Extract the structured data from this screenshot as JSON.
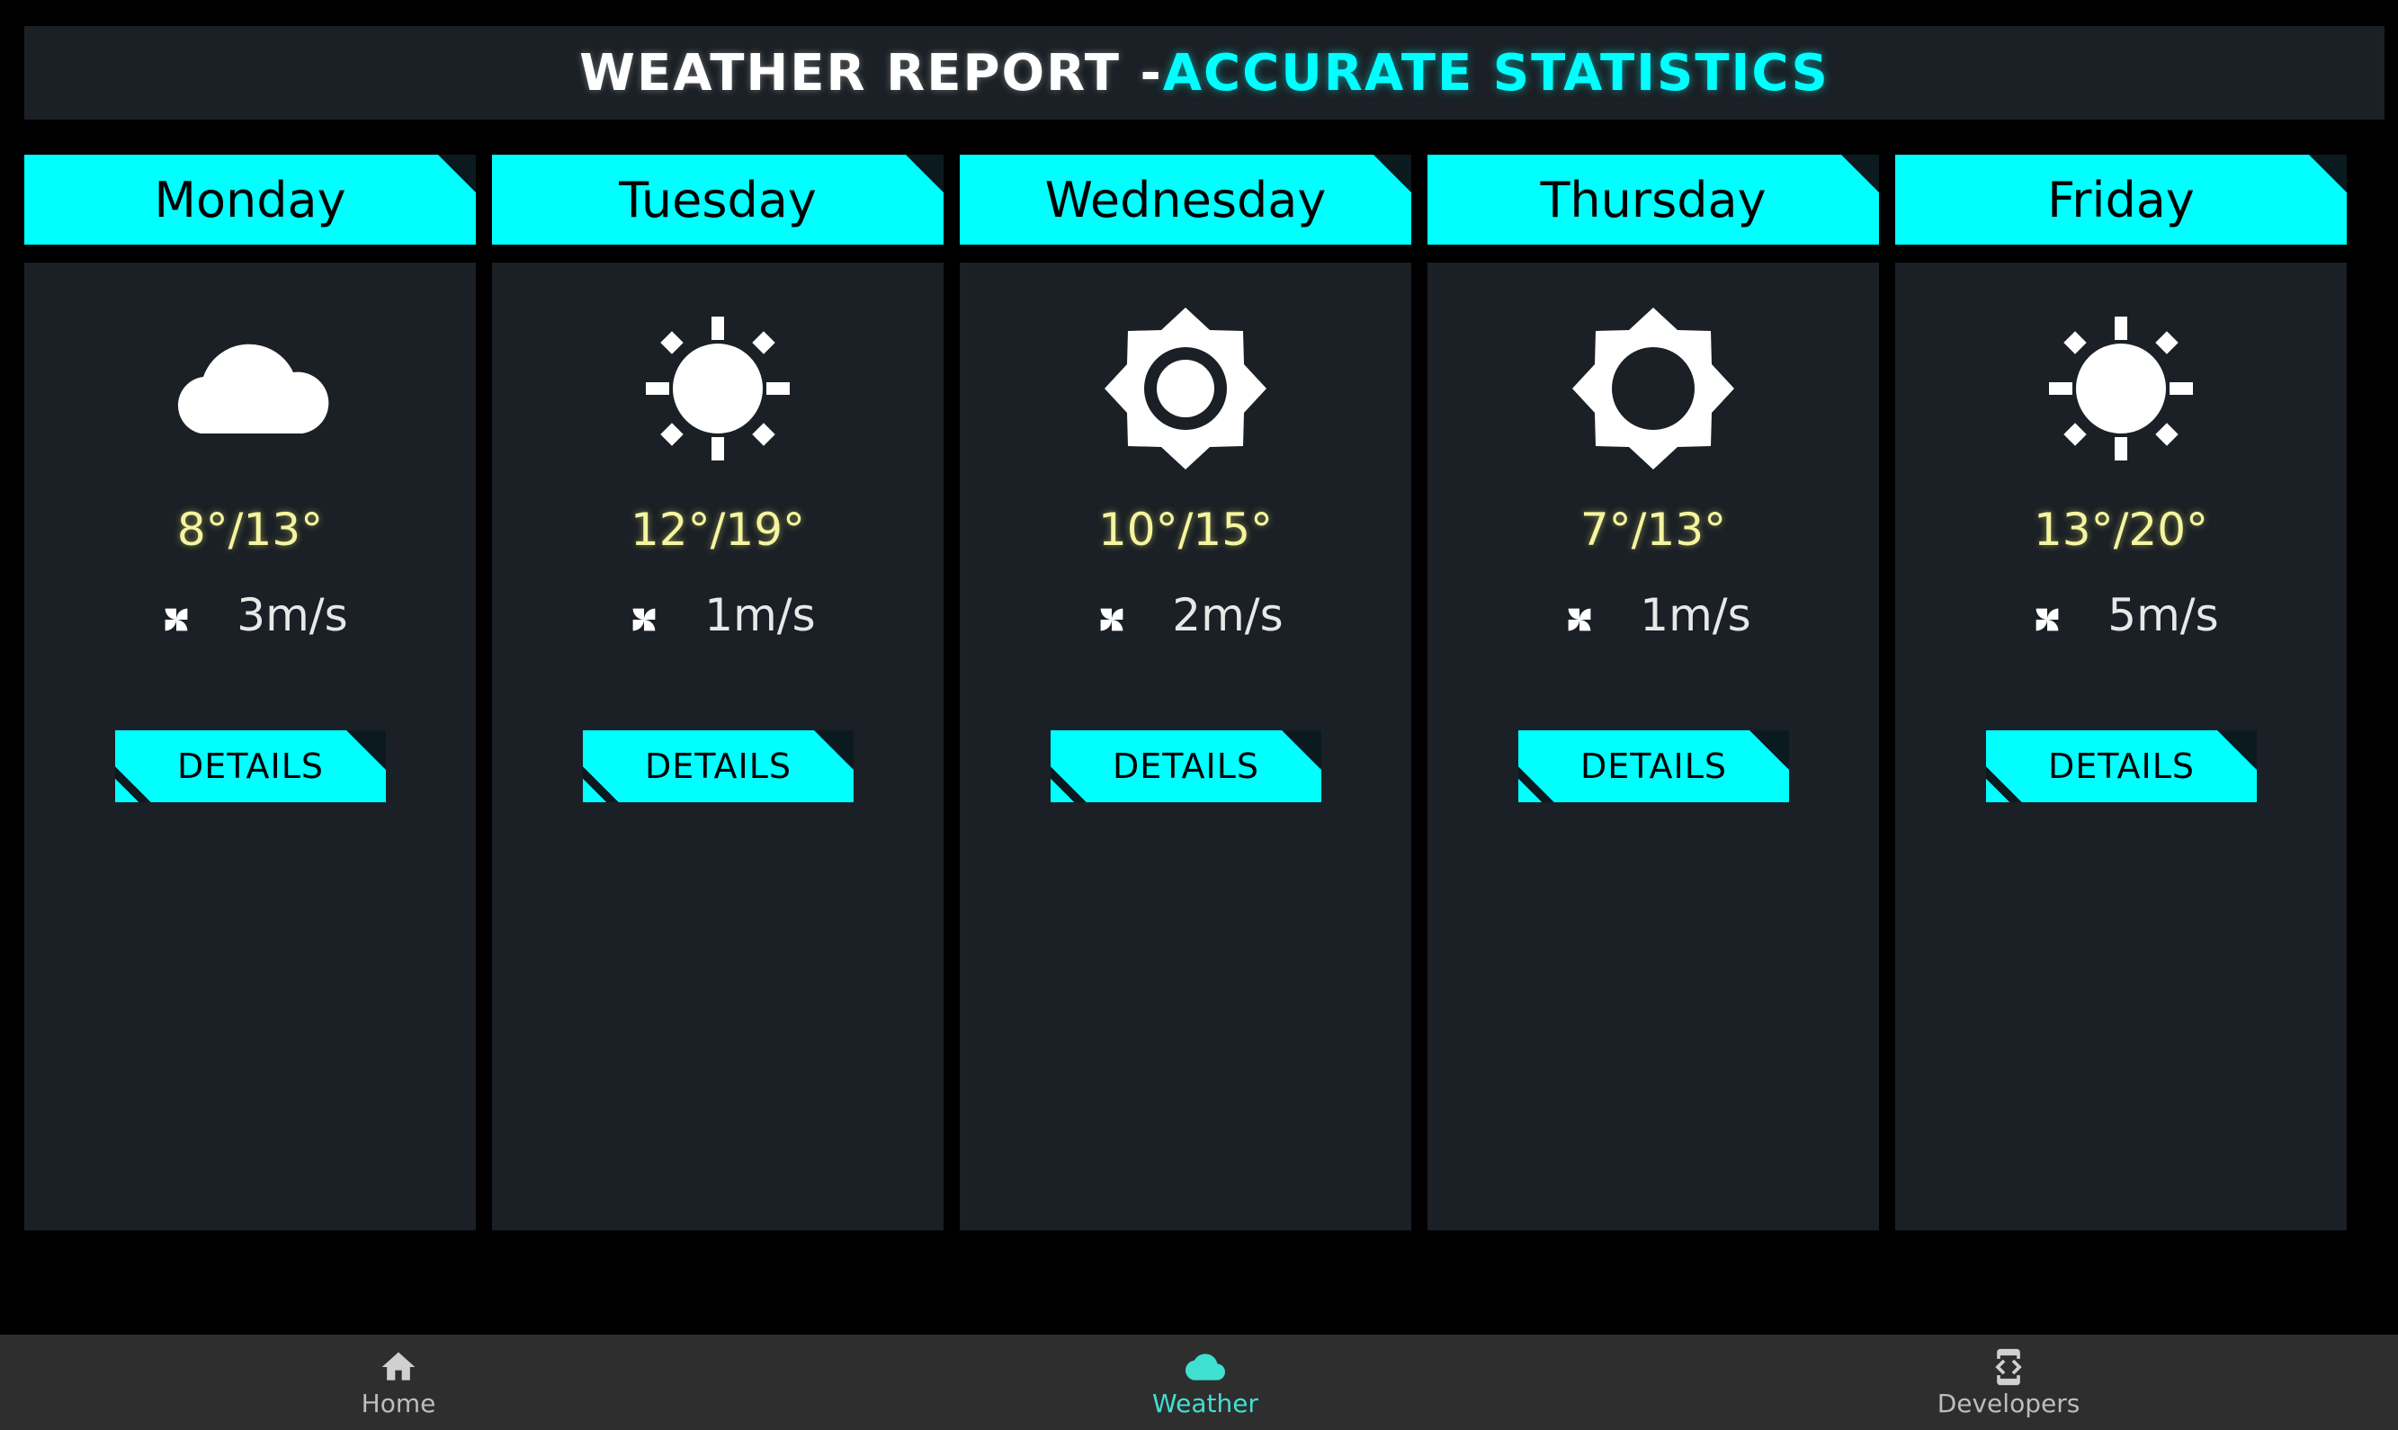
{
  "header": {
    "title_main": "WEATHER REPORT - ",
    "title_accent": "ACCURATE STATISTICS"
  },
  "days": [
    {
      "name": "Monday",
      "icon": "cloud-icon",
      "temp": "8°/13°",
      "wind": "3m/s",
      "details_label": "DETAILS"
    },
    {
      "name": "Tuesday",
      "icon": "sun-icon",
      "temp": "12°/19°",
      "wind": "1m/s",
      "details_label": "DETAILS"
    },
    {
      "name": "Wednesday",
      "icon": "brightness-high-icon",
      "temp": "10°/15°",
      "wind": "2m/s",
      "details_label": "DETAILS"
    },
    {
      "name": "Thursday",
      "icon": "brightness-low-icon",
      "temp": "7°/13°",
      "wind": "1m/s",
      "details_label": "DETAILS"
    },
    {
      "name": "Friday",
      "icon": "sun-icon",
      "temp": "13°/20°",
      "wind": "5m/s",
      "details_label": "DETAILS"
    }
  ],
  "nav": {
    "items": [
      {
        "label": "Home",
        "icon": "home-icon"
      },
      {
        "label": "Weather",
        "icon": "cloud-icon",
        "active": true
      },
      {
        "label": "Developers",
        "icon": "developer-mode-icon"
      }
    ]
  },
  "colors": {
    "accent": "#00ffff",
    "card": "#1a2025",
    "temp": "#f5f5a0",
    "nav_active": "#40e0d0",
    "nav_bg": "#2e2e2e"
  }
}
